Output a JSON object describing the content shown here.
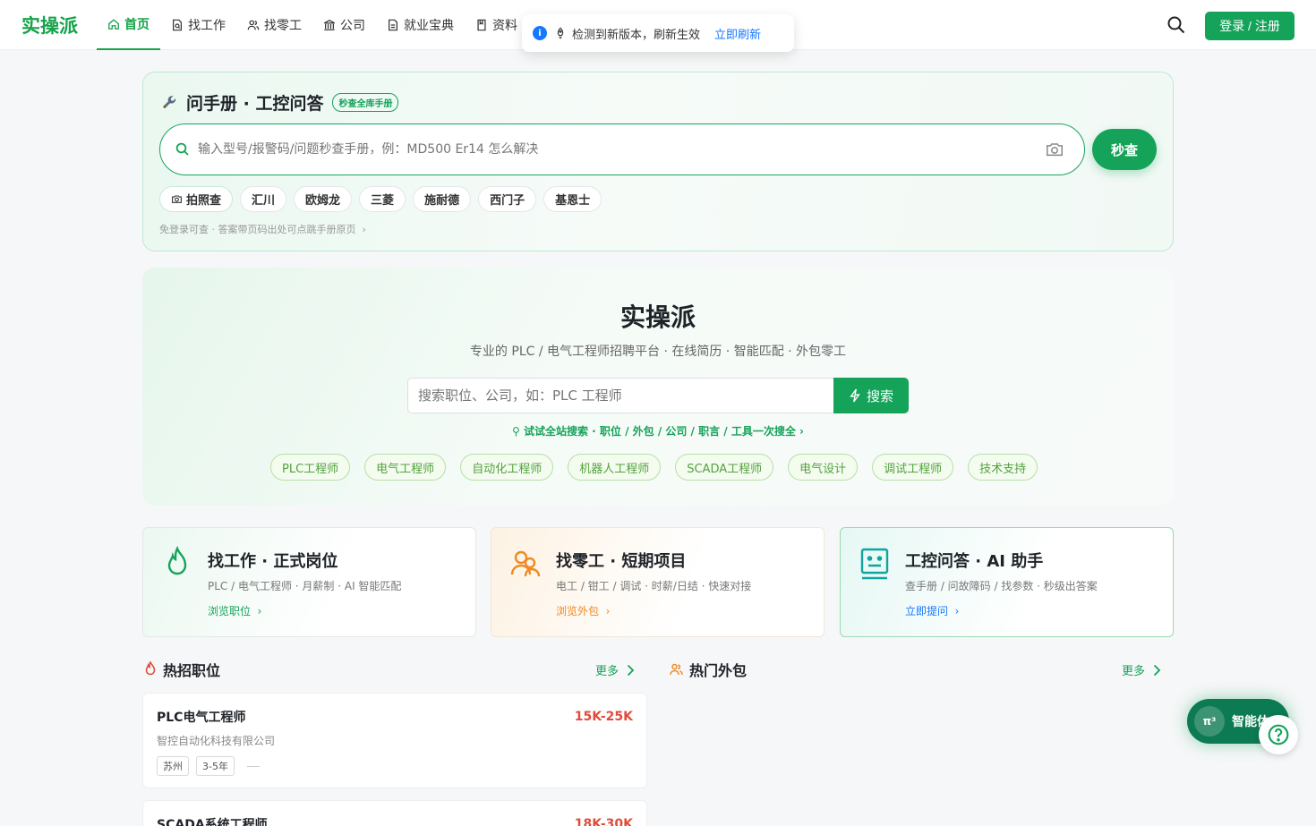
{
  "brand": "实操派",
  "nav": [
    {
      "label": "首页",
      "icon": "home-icon",
      "active": true
    },
    {
      "label": "找工作",
      "icon": "document-search-icon"
    },
    {
      "label": "找零工",
      "icon": "users-icon"
    },
    {
      "label": "公司",
      "icon": "bank-icon"
    },
    {
      "label": "就业宝典",
      "icon": "document-icon"
    },
    {
      "label": "资料",
      "icon": "file-icon"
    }
  ],
  "header": {
    "login_label": "登录 / 注册"
  },
  "toast": {
    "message": "检测到新版本，刷新生效",
    "action": "立即刷新"
  },
  "manual": {
    "title": "问手册 · 工控问答",
    "badge": "秒查全库手册",
    "placeholder": "输入型号/报警码/问题秒查手册，例：MD500 Er14 怎么解决",
    "button": "秒查",
    "chips": [
      "拍照查",
      "汇川",
      "欧姆龙",
      "三菱",
      "施耐德",
      "西门子",
      "基恩士"
    ],
    "note": "免登录可查 · 答案带页码出处可点跳手册原页"
  },
  "hero": {
    "title": "实操派",
    "subtitle": "专业的 PLC / 电气工程师招聘平台 · 在线简历 · 智能匹配 · 外包零工",
    "placeholder": "搜索职位、公司，如：PLC 工程师",
    "button": "搜索",
    "link": "试试全站搜索 · 职位 / 外包 / 公司 / 职言 / 工具一次搜全 ›",
    "tags": [
      "PLC工程师",
      "电气工程师",
      "自动化工程师",
      "机器人工程师",
      "SCADA工程师",
      "电气设计",
      "调试工程师",
      "技术支持"
    ]
  },
  "features": [
    {
      "title": "找工作 · 正式岗位",
      "desc": "PLC / 电气工程师 · 月薪制 · AI 智能匹配",
      "link": "浏览职位",
      "color": "#15a35a",
      "icon": "flame-icon"
    },
    {
      "title": "找零工 · 短期项目",
      "desc": "电工 / 钳工 / 调试 · 时薪/日结 · 快速对接",
      "link": "浏览外包",
      "color": "#f08a24",
      "icon": "users-icon"
    },
    {
      "title": "工控问答 · AI 助手",
      "desc": "查手册 / 问故障码 / 找参数 · 秒级出答案",
      "link": "立即提问",
      "color": "#0ea5a0",
      "icon": "robot-icon"
    }
  ],
  "sections": {
    "hot_jobs": {
      "title": "热招职位",
      "more": "更多"
    },
    "hot_gigs": {
      "title": "热门外包",
      "more": "更多"
    }
  },
  "jobs": [
    {
      "title": "PLC电气工程师",
      "company": "智控自动化科技有限公司",
      "salary": "15K-25K",
      "tags": [
        "苏州",
        "3-5年"
      ]
    },
    {
      "title": "SCADA系统工程师",
      "company": "",
      "salary": "18K-30K",
      "tags": []
    }
  ],
  "ai_float": {
    "label": "智能体",
    "mark": "π³"
  }
}
